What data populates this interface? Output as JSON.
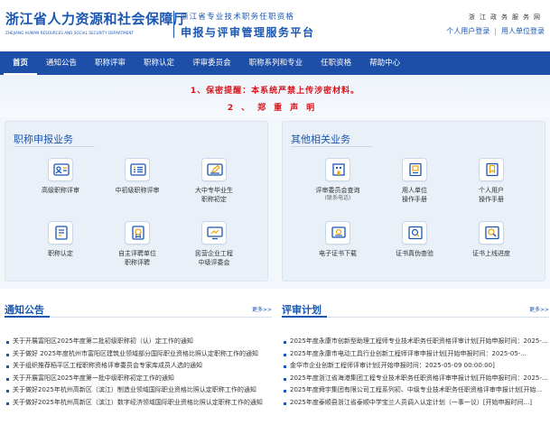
{
  "header": {
    "dept_title": "浙江省人力资源和社会保障厅",
    "dept_subtitle": "ZHEJIANG HUMAN RESOURCES AND SOCIAL SECURITY DEPARTMENT",
    "system_line1": "浙江省专业技术职务任职资格",
    "system_line2": "申报与评审管理服务平台",
    "gov_link": "浙江政务服务网",
    "personal_login": "个人用户登录",
    "org_login": "用人单位登录"
  },
  "nav": {
    "items": [
      {
        "label": "首页",
        "active": true
      },
      {
        "label": "通知公告"
      },
      {
        "label": "职称评审"
      },
      {
        "label": "职称认定"
      },
      {
        "label": "评审委员会"
      },
      {
        "label": "职称系列和专业"
      },
      {
        "label": "任职资格"
      },
      {
        "label": "帮助中心"
      }
    ]
  },
  "banner": {
    "notice1": "1、保密提醒：本系统严禁上传涉密材料。",
    "notice2": "2、郑重声明"
  },
  "panels": {
    "left": {
      "title": "职称申报业务",
      "tiles": [
        {
          "label": "高级职称评审",
          "icon": "id-card-icon"
        },
        {
          "label": "中初级职称评审",
          "icon": "list-card-icon"
        },
        {
          "label": "大中专毕业生",
          "label2": "职称初定",
          "icon": "edit-pencil-icon"
        },
        {
          "label": "职称认定",
          "icon": "document-icon"
        },
        {
          "label": "自主评聘单位",
          "label2": "职称评聘",
          "icon": "medal-icon"
        },
        {
          "label": "民营企业工程",
          "label2": "中级评委会",
          "icon": "monitor-icon"
        }
      ]
    },
    "right": {
      "title": "其他相关业务",
      "tiles": [
        {
          "label": "评审委员会查询",
          "sub": "(联系电话)",
          "icon": "building-icon"
        },
        {
          "label": "用人单位",
          "label2": "操作手册",
          "icon": "book-icon"
        },
        {
          "label": "个人用户",
          "label2": "操作手册",
          "icon": "bookmark-icon"
        },
        {
          "label": "电子证书下载",
          "icon": "certificate-icon"
        },
        {
          "label": "证书真伪查验",
          "icon": "magnify-check-icon"
        },
        {
          "label": "证书上线进度",
          "icon": "search-icon"
        }
      ]
    }
  },
  "news": {
    "left": {
      "title": "通知公告",
      "more": "更多>>",
      "items": [
        "关于开展富阳区2025年度第二批初级职称初（认）定工作的通知",
        "关于做好 2025年度杭州市富阳区建筑业领域部分国际职业资格比照认定职称工作的通知",
        "关于组织推荐稻平区工程职称资格评审委员会专家库成员人选的通知",
        "关于开展富阳区2025年度第一批中级职称初定工作的通知",
        "关于做好2025年杭州高新区（滨江）制造业领域国际职业资格比照认定职称工作的通知",
        "关于做好2025年杭州高新区（滨江）数字经济领域国际职业资格比照认定职称工作的通知"
      ]
    },
    "right": {
      "title": "评审计划",
      "more": "更多>>",
      "items": [
        "2025年度永康市创新型助理工程师专业技术职务任职资格评审计划[开始申报时间：2025-05-...",
        "2025年度永康市电动工具行业创新工程师评审申报计划[开始申报时间：2025-05-...",
        "金华市企业创新工程师评审计划[开始申报时间：2025-05-09 00:00:00]",
        "2025年度浙江省海港集团工程专业技术职务任职资格评审申报计划[开始申报时间：2025-...",
        "2025年度舜宇集团有限公司工程系列初、中级专业技术职务任职资格评审申报计划[开始...",
        "2025年度泰顺县浙江省泰顺中学宝兰人员调入认定计划（一事一议）[开始申报时间...]"
      ]
    }
  },
  "colors": {
    "brand_blue": "#1d4ea8",
    "notice_red": "#d8141a"
  }
}
